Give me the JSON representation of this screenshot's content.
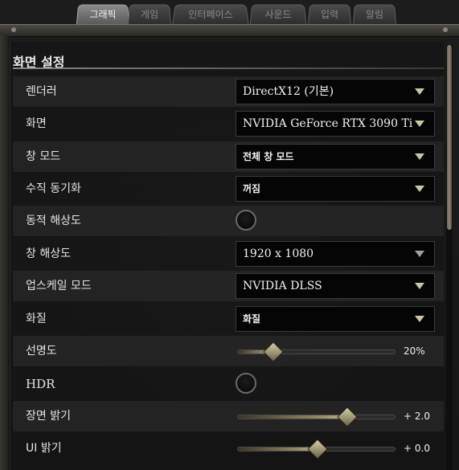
{
  "tabs": [
    {
      "label": "그래픽",
      "active": true
    },
    {
      "label": "게임",
      "active": false
    },
    {
      "label": "인터페이스",
      "active": false
    },
    {
      "label": "사운드",
      "active": false
    },
    {
      "label": "입력",
      "active": false
    },
    {
      "label": "알림",
      "active": false
    }
  ],
  "section": {
    "title": "화면 설정"
  },
  "settings": {
    "renderer": {
      "label": "렌더러",
      "value": "DirectX12 (기본)"
    },
    "display": {
      "label": "화면",
      "value": "NVIDIA GeForce RTX 3090 Ti"
    },
    "window_mode": {
      "label": "창 모드",
      "value": "전체 창 모드"
    },
    "vsync": {
      "label": "수직 동기화",
      "value": "꺼짐"
    },
    "dynamic_res": {
      "label": "동적 해상도",
      "enabled": false
    },
    "window_res": {
      "label": "창 해상도",
      "value": "1920 x 1080"
    },
    "upscale": {
      "label": "업스케일 모드",
      "value": "NVIDIA DLSS"
    },
    "quality": {
      "label": "화질",
      "value": "화질"
    },
    "sharpness": {
      "label": "선명도",
      "display": "20%",
      "fraction": 0.22
    },
    "hdr": {
      "label": "HDR",
      "enabled": false
    },
    "scene_brightness": {
      "label": "장면 밝기",
      "display": "+ 2.0",
      "fraction": 0.69
    },
    "ui_brightness": {
      "label": "UI 밝기",
      "display": "+ 0.0",
      "fraction": 0.5
    }
  },
  "colors": {
    "accent": "#c5b686",
    "background": "#161616"
  }
}
